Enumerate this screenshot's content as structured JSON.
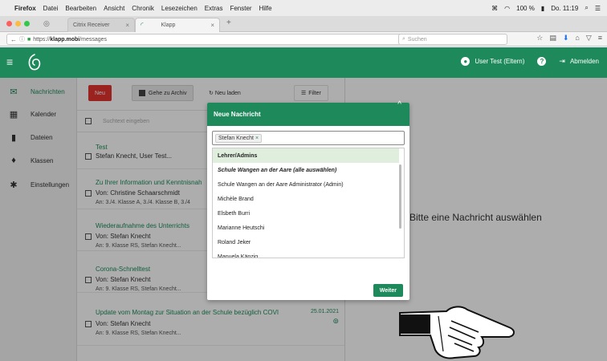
{
  "menubar": {
    "app": "Firefox",
    "items": [
      "Datei",
      "Bearbeiten",
      "Ansicht",
      "Chronik",
      "Lesezeichen",
      "Extras",
      "Fenster",
      "Hilfe"
    ],
    "battery": "100 %",
    "clock": "Do. 11:19"
  },
  "tabs": [
    {
      "label": "Citrix Receiver",
      "close": "×"
    },
    {
      "label": "Klapp",
      "close": "×"
    }
  ],
  "tab_new": "+",
  "urlbar": {
    "prefix": "https://",
    "host": "klapp.mobi",
    "path": "/messages"
  },
  "search": {
    "placeholder": "Suchen"
  },
  "header": {
    "user_label": "User Test (Eltern)",
    "help_label": "?",
    "logout_label": "Abmelden"
  },
  "sidebar": {
    "items": [
      {
        "label": "Nachrichten",
        "icon": "envelope-icon",
        "active": true
      },
      {
        "label": "Kalender",
        "icon": "calendar-icon"
      },
      {
        "label": "Dateien",
        "icon": "file-icon"
      },
      {
        "label": "Klassen",
        "icon": "graduation-cap-icon"
      },
      {
        "label": "Einstellungen",
        "icon": "gear-icon"
      }
    ]
  },
  "toolbar": {
    "new_label": "Neu",
    "archive_label": "Gehe zu Archiv",
    "reload_label": "Neu laden",
    "filter_label": "Filter"
  },
  "list_search": {
    "placeholder": "Suchtext eingeben"
  },
  "messages": [
    {
      "subject": "Test",
      "from": "Stefan Knecht, User Test...",
      "to": "",
      "date": ""
    },
    {
      "subject": "Zu Ihrer Information und Kenntnisnah",
      "from": "Von: Christine Schaarschmidt",
      "to": "An: 3./4. Klasse A, 3./4. Klasse B, 3./4",
      "date": ""
    },
    {
      "subject": "Wiederaufnahme des Unterrichts",
      "from": "Von: Stefan Knecht",
      "to": "An: 9. Klasse RS, Stefan Knecht...",
      "date": ""
    },
    {
      "subject": "Corona-Schnelltest",
      "from": "Von: Stefan Knecht",
      "to": "An: 9. Klasse RS, Stefan Knecht...",
      "date": ""
    },
    {
      "subject": "Update vom Montag zur Situation an der Schule bezüglich COVI",
      "from": "Von: Stefan Knecht",
      "to": "An: 9. Klasse RS, Stefan Knecht...",
      "date": "25.01.2021"
    }
  ],
  "detail": {
    "hint": "Bitte eine Nachricht auswählen"
  },
  "modal": {
    "title": "Neue Nachricht",
    "close": "^",
    "tag": "Stefan Knecht",
    "tag_remove": "×",
    "options": [
      {
        "label": "Lehrer/Admins",
        "kind": "group"
      },
      {
        "label": "Schule Wangen an der Aare (alle auswählen)",
        "kind": "italic"
      },
      {
        "label": "Schule Wangen an der Aare Administrator (Admin)",
        "kind": "normal"
      },
      {
        "label": "Michèle Brand",
        "kind": "normal"
      },
      {
        "label": "Elsbeth Burri",
        "kind": "normal"
      },
      {
        "label": "Marianne Heutschi",
        "kind": "normal"
      },
      {
        "label": "Roland Jeker",
        "kind": "normal"
      },
      {
        "label": "Manuela Känzig",
        "kind": "normal"
      }
    ],
    "submit": "Weiter"
  },
  "colors": {
    "brand": "#1e8a5b",
    "danger": "#e3342f"
  }
}
